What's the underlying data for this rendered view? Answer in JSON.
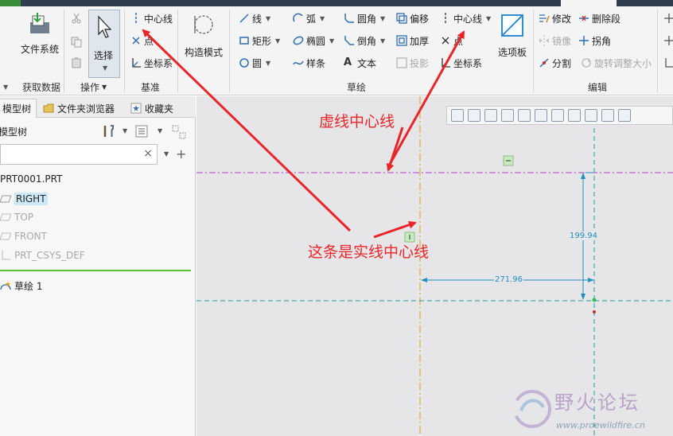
{
  "ribbon": {
    "groups": {
      "get_data": "获取数据",
      "operations": "操作",
      "datum": "基准",
      "sketch": "草绘",
      "edit": "编辑"
    },
    "get_data": {
      "file_system": "文件系统"
    },
    "operations": {
      "select": "选择"
    },
    "datum": {
      "centerline": "中心线",
      "point": "点",
      "coord_system": "坐标系"
    },
    "construction_mode": "构造模式",
    "sketch": {
      "line": "线",
      "rectangle": "矩形",
      "circle": "圆",
      "arc": "弧",
      "ellipse": "椭圆",
      "spline": "样条",
      "fillet": "圆角",
      "chamfer": "倒角",
      "text": "文本",
      "offset": "偏移",
      "thicken": "加厚",
      "project": "投影",
      "centerline": "中心线",
      "point": "点",
      "coord_system": "坐标系",
      "palette": "选项板"
    },
    "edit": {
      "modify": "修改",
      "delete_segment": "删除段",
      "mirror": "镜像",
      "corner": "拐角",
      "divide": "分割",
      "rotate_resize": "旋转调整大小"
    }
  },
  "left_panel": {
    "tabs": [
      "模型树",
      "文件夹浏览器",
      "收藏夹"
    ],
    "tree_title": "模型树",
    "search_value": "",
    "items": [
      {
        "label": "PRT0001.PRT",
        "state": "normal"
      },
      {
        "label": "RIGHT",
        "state": "selected"
      },
      {
        "label": "TOP",
        "state": "dim"
      },
      {
        "label": "FRONT",
        "state": "dim"
      },
      {
        "label": "PRT_CSYS_DEF",
        "state": "dim"
      }
    ],
    "sketch_item": "草绘 1"
  },
  "graphics": {
    "annotation_dashed": "虚线中心线",
    "annotation_solid": "这条是实线中心线",
    "dim_vertical": "199.94",
    "dim_horizontal": "271.96",
    "colors": {
      "annotation": "#e8262a",
      "centerline_h": "#b040c8",
      "centerline_v": "#e0a020",
      "reference": "#20a0a0",
      "dimension": "#1d8fc0"
    }
  },
  "watermark": {
    "brand": "野火论坛",
    "url": "www.proewildfire.cn"
  }
}
